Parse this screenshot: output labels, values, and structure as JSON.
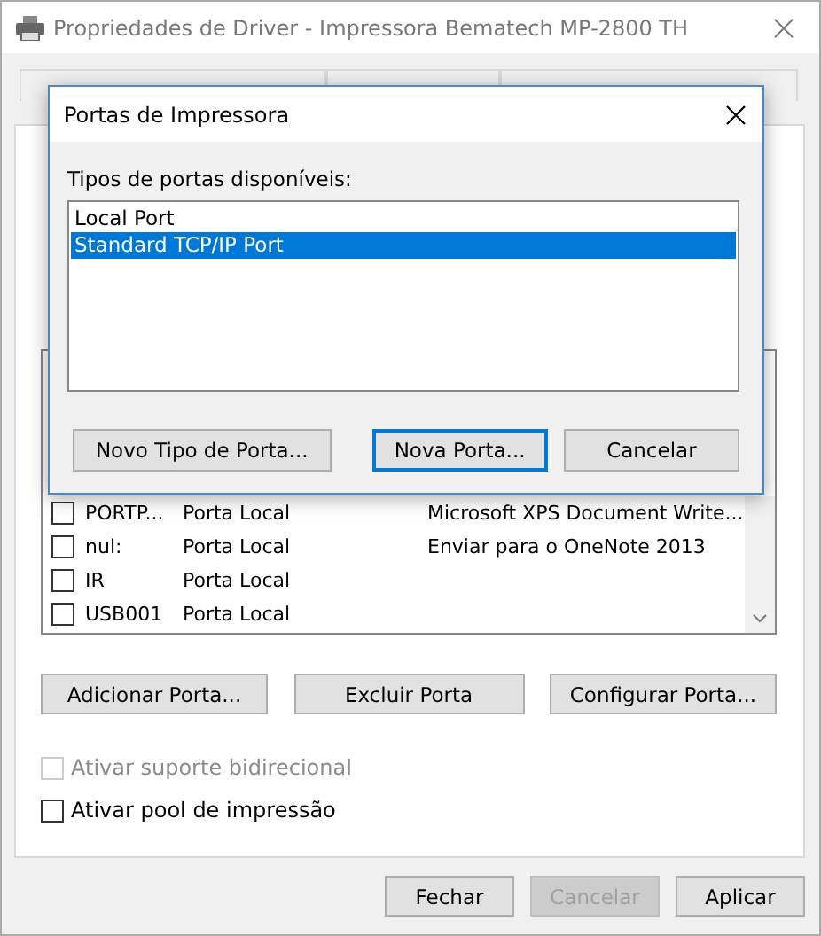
{
  "window": {
    "title": "Propriedades de Driver - Impressora Bematech MP-2800 TH"
  },
  "tabs": [
    {
      "selected": false
    },
    {
      "selected": false
    },
    {
      "selected": false
    }
  ],
  "ports": [
    {
      "name": "PORTP...",
      "description": "Porta Local",
      "printer": "Microsoft XPS Document Write...",
      "checked": false
    },
    {
      "name": "nul:",
      "description": "Porta Local",
      "printer": "Enviar para o OneNote 2013",
      "checked": false
    },
    {
      "name": "IR",
      "description": "Porta Local",
      "checked": false
    },
    {
      "name": "USB001",
      "description": "Porta Local",
      "checked": false
    }
  ],
  "port_buttons": [
    "Adicionar Porta...",
    "Excluir Porta",
    "Configurar Porta..."
  ],
  "options": [
    {
      "label": "Ativar suporte bidirecional",
      "checked": false,
      "disabled": true
    },
    {
      "label": "Ativar pool de impressão",
      "checked": false,
      "disabled": false
    }
  ],
  "footer_buttons": [
    {
      "label": "Fechar",
      "disabled": false
    },
    {
      "label": "Cancelar",
      "disabled": true
    },
    {
      "label": "Aplicar",
      "disabled": false
    }
  ],
  "dialog": {
    "title": "Portas de Impressora",
    "list_label": "Tipos de portas disponíveis:",
    "port_types": [
      {
        "label": "Local Port",
        "selected": false
      },
      {
        "label": "Standard TCP/IP Port",
        "selected": true
      }
    ],
    "buttons": [
      {
        "label": "Novo Tipo de Porta...",
        "default": false
      },
      {
        "label": "Nova Porta...",
        "default": true
      },
      {
        "label": "Cancelar",
        "default": false
      }
    ]
  }
}
